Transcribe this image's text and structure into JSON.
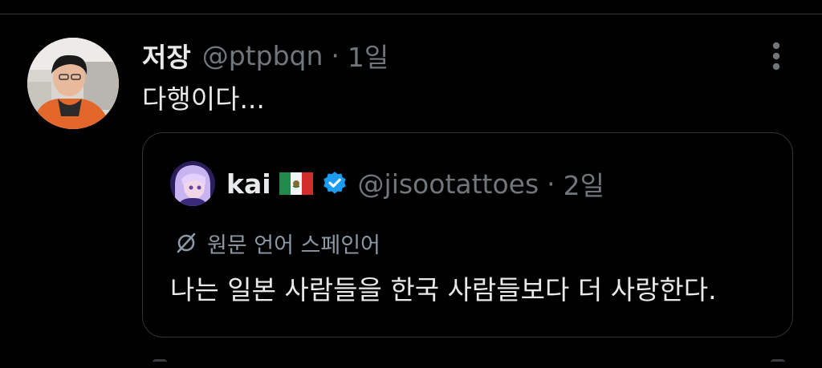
{
  "post": {
    "author_name": "저장",
    "author_handle": "@ptpbqn",
    "separator": "·",
    "time": "1일",
    "text": "다행이다..."
  },
  "quote": {
    "author_name": "kai",
    "flag_icon": "mexico-flag-icon",
    "verified_icon": "verified-badge-icon",
    "author_handle": "@jisootattoes",
    "separator": "·",
    "time": "2일",
    "translate_label": "원문 언어 스페인어",
    "text": "나는 일본 사람들을 한국 사람들보다 더 사랑한다."
  },
  "colors": {
    "background": "#000000",
    "primary_text": "#e7e9ea",
    "secondary_text": "#71767b",
    "border": "#2f3336",
    "verified_blue": "#1d9bf0"
  }
}
